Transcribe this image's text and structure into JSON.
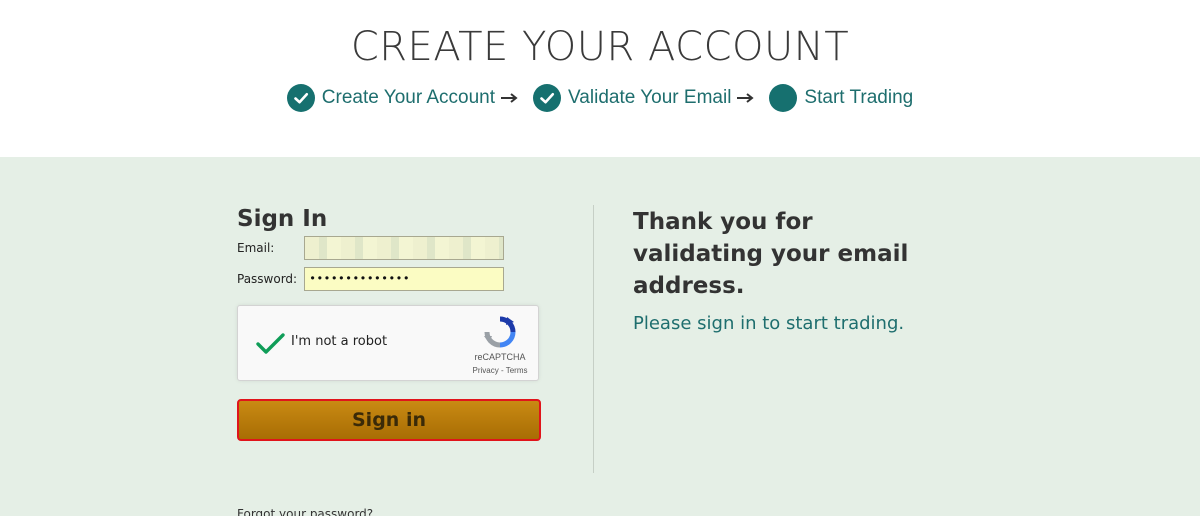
{
  "header": {
    "title": "CREATE YOUR ACCOUNT",
    "steps": [
      {
        "label": "Create Your Account",
        "status": "complete"
      },
      {
        "label": "Validate Your Email",
        "status": "complete"
      },
      {
        "label": "Start Trading",
        "status": "current"
      }
    ],
    "step_color": "#16706f"
  },
  "signin": {
    "title": "Sign In",
    "email_label": "Email:",
    "email_value": "",
    "password_label": "Password:",
    "password_value": "••••••••••••••",
    "captcha": {
      "label": "I'm not a robot",
      "brand": "reCAPTCHA",
      "links": "Privacy - Terms",
      "checked": true
    },
    "button_label": "Sign in",
    "forgot_label": "Forgot your password?"
  },
  "message": {
    "title": "Thank you for validating your email address.",
    "subtitle": "Please sign in to start trading."
  },
  "colors": {
    "panel_bg": "#e5efe6",
    "accent": "#1e6e6e",
    "button": "#b77a0a",
    "button_border": "#e0141b"
  }
}
